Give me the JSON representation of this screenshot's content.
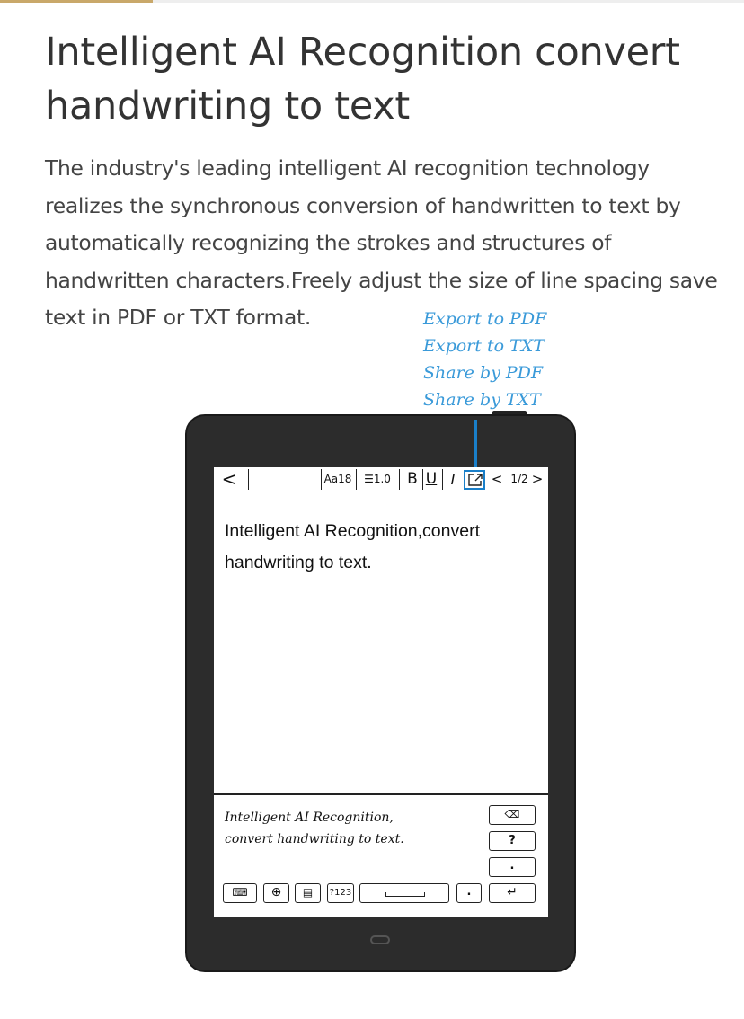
{
  "header": {
    "title": "Intelligent AI Recognition convert handwriting to text",
    "description": "The industry's leading intelligent AI recognition technology realizes the synchronous conversion of handwritten to text by automatically recognizing the strokes and structures of handwritten characters.Freely adjust the size of line spacing save text in PDF or TXT format."
  },
  "export_options": [
    "Export to PDF",
    "Export to TXT",
    "Share by PDF",
    "Share by TXT"
  ],
  "toolbar": {
    "back": "<",
    "font_size": "Aa18",
    "line_spacing": "☰1.0",
    "bold": "B",
    "underline": "U",
    "italic": "I",
    "share": "<",
    "page": "1/2",
    "next": ">"
  },
  "document": {
    "text": "Intelligent AI Recognition,convert handwriting to text."
  },
  "handwriting": {
    "line1": "Intelligent AI Recognition,",
    "line2": "convert handwriting to text."
  },
  "keyboard": {
    "backspace": "⌫",
    "question": "?",
    "period_side": ".",
    "keyboard_toggle": "⌨",
    "globe": "⊕",
    "layout": "▤",
    "numbers": "?123",
    "period": ".",
    "enter": "↵"
  },
  "colors": {
    "accent_blue": "#1a7fc9",
    "handnote_blue": "#3a9ad9",
    "device_body": "#2c2c2c",
    "top_accent": "#c9a86a"
  }
}
